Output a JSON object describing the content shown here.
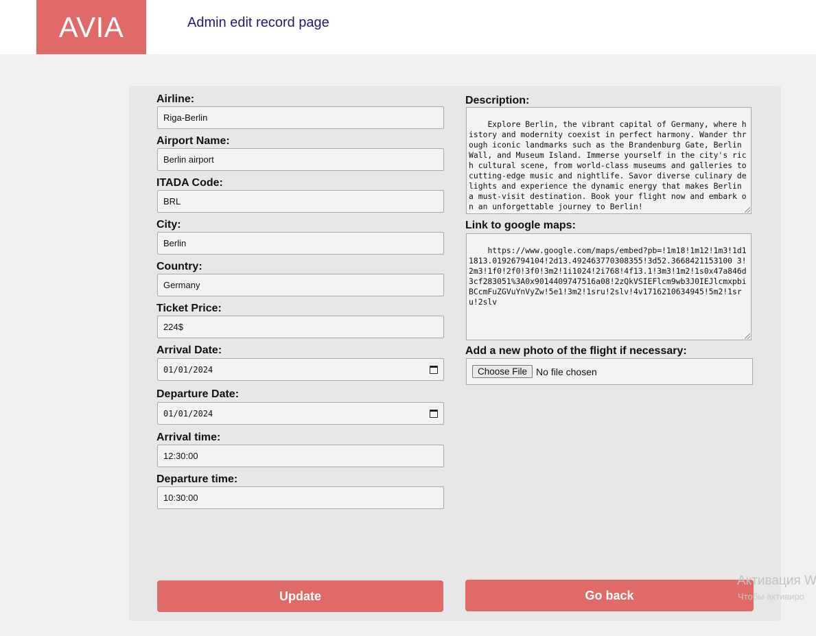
{
  "header": {
    "logo": "AVIA",
    "title": "Admin edit record page"
  },
  "form": {
    "airline": {
      "label": "Airline:",
      "value": "Riga-Berlin"
    },
    "airport_name": {
      "label": "Airport Name:",
      "value": "Berlin airport"
    },
    "itada_code": {
      "label": "ITADA Code:",
      "value": "BRL"
    },
    "city": {
      "label": "City:",
      "value": "Berlin"
    },
    "country": {
      "label": "Country:",
      "value": "Germany"
    },
    "ticket_price": {
      "label": "Ticket Price:",
      "value": "224$"
    },
    "arrival_date": {
      "label": "Arrival Date:",
      "value": "01/01/2024"
    },
    "departure_date": {
      "label": "Departure Date:",
      "value": "01/01/2024"
    },
    "arrival_time": {
      "label": "Arrival time:",
      "value": "12:30:00"
    },
    "departure_time": {
      "label": "Departure time:",
      "value": "10:30:00"
    },
    "description": {
      "label": "Description:",
      "value": "Explore Berlin, the vibrant capital of Germany, where history and modernity coexist in perfect harmony. Wander through iconic landmarks such as the Brandenburg Gate, Berlin Wall, and Museum Island. Immerse yourself in the city's rich cultural scene, from world-class museums and galleries to cutting-edge music and nightlife. Savor diverse culinary delights and experience the dynamic energy that makes Berlin a must-visit destination. Book your flight now and embark on an unforgettable journey to Berlin!"
    },
    "maps_link": {
      "label": "Link to google maps:",
      "value": "https://www.google.com/maps/embed?pb=!1m18!1m12!1m3!1d11813.01926794104!2d13.492463770308355!3d52.3668421153100 3!2m3!1f0!2f0!3f0!3m2!1i1024!2i768!4f13.1!3m3!1m2!1s0x47a846d3cf283051%3A0x9014409747516a08!2zQkVSIEFlcm9wb3J0IEJlcmxpbiBCcmFuZGVuYnVyZw!5e1!3m2!1sru!2slv!4v1716210634945!5m2!1sru!2slv"
    },
    "photo": {
      "label": "Add a new photo of the flight if necessary:",
      "button": "Choose File",
      "status": "No file chosen"
    }
  },
  "actions": {
    "update": "Update",
    "go_back": "Go back"
  },
  "overlay": {
    "watermark_line1": "Активация W",
    "watermark_line2": "Чтобы активиро"
  },
  "colors": {
    "accent": "#e06a68",
    "title_text": "#1d1a7a",
    "panel_bg": "#e7e7e7",
    "page_bg": "#f1f1f1"
  }
}
